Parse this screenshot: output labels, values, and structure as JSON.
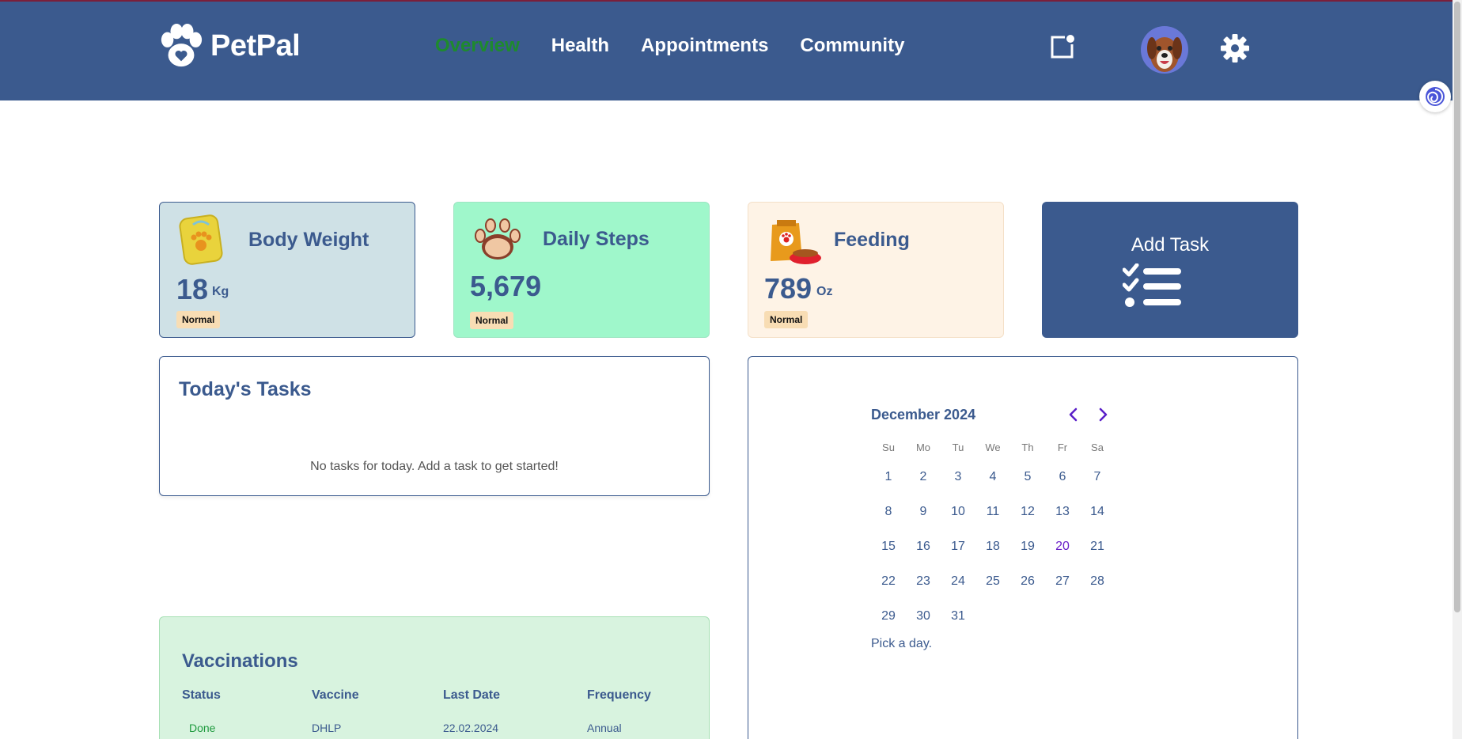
{
  "app": {
    "name": "PetPal"
  },
  "nav": {
    "items": [
      {
        "label": "Overview",
        "active": true
      },
      {
        "label": "Health"
      },
      {
        "label": "Appointments"
      },
      {
        "label": "Community"
      }
    ]
  },
  "header_icons": [
    "notification-icon",
    "avatar",
    "gear-icon"
  ],
  "stats": {
    "weight": {
      "title": "Body Weight",
      "value": "18",
      "unit": "Kg",
      "status": "Normal",
      "icon": "scale-paw-icon"
    },
    "steps": {
      "title": "Daily Steps",
      "value": "5,679",
      "status": "Normal",
      "icon": "paw-icon"
    },
    "feeding": {
      "title": "Feeding",
      "value": "789",
      "unit": "Oz",
      "status": "Normal",
      "icon": "food-bag-icon"
    }
  },
  "add_task": {
    "label": "Add Task",
    "icon": "checklist-icon"
  },
  "tasks": {
    "title": "Today's Tasks",
    "empty_message": "No tasks for today. Add a task to get started!"
  },
  "calendar": {
    "month_label": "December 2024",
    "weekdays": [
      "Su",
      "Mo",
      "Tu",
      "We",
      "Th",
      "Fr",
      "Sa"
    ],
    "weeks": [
      [
        "1",
        "2",
        "3",
        "4",
        "5",
        "6",
        "7"
      ],
      [
        "8",
        "9",
        "10",
        "11",
        "12",
        "13",
        "14"
      ],
      [
        "15",
        "16",
        "17",
        "18",
        "19",
        "20",
        "21"
      ],
      [
        "22",
        "23",
        "24",
        "25",
        "26",
        "27",
        "28"
      ],
      [
        "29",
        "30",
        "31",
        "",
        "",
        "",
        ""
      ]
    ],
    "today": "20",
    "footer": "Pick a day."
  },
  "vaccinations": {
    "title": "Vaccinations",
    "columns": [
      "Status",
      "Vaccine",
      "Last Date",
      "Frequency"
    ],
    "rows": [
      [
        "Done",
        "DHLP",
        "22.02.2024",
        "Annual"
      ]
    ]
  },
  "colors": {
    "header_bg": "#3b5a8e",
    "active_nav": "#1e8a2e",
    "weight_card": "#cfe1e6",
    "steps_card": "#9ff7cb",
    "feeding_card": "#fef3e6",
    "vacc_panel": "#d8f3df",
    "badge": "#f8ddb4"
  }
}
